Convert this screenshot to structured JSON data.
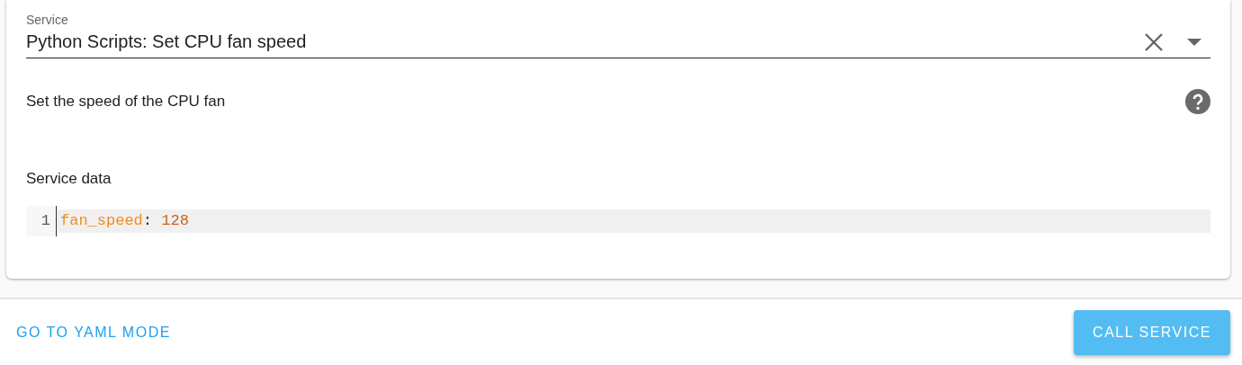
{
  "service_field": {
    "label": "Service",
    "value": "Python Scripts: Set CPU fan speed"
  },
  "description": "Set the speed of the CPU fan",
  "service_data": {
    "label": "Service data",
    "lines": [
      {
        "number": "1",
        "tokens": [
          {
            "kind": "key",
            "text": "fan_speed"
          },
          {
            "kind": "punct",
            "text": ":"
          },
          {
            "kind": "number",
            "text": " 128"
          }
        ]
      }
    ]
  },
  "footer": {
    "link": "GO TO YAML MODE",
    "button": "CALL SERVICE"
  }
}
